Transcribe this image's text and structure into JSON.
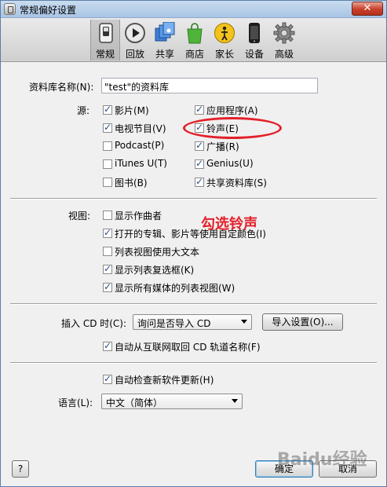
{
  "window": {
    "title": "常规偏好设置",
    "close_label": "✕"
  },
  "toolbar": {
    "items": [
      {
        "label": "常规",
        "icon": "switch-icon"
      },
      {
        "label": "回放",
        "icon": "play-icon"
      },
      {
        "label": "共享",
        "icon": "sharing-icon"
      },
      {
        "label": "商店",
        "icon": "store-bag-icon"
      },
      {
        "label": "家长",
        "icon": "parental-icon"
      },
      {
        "label": "设备",
        "icon": "iphone-icon"
      },
      {
        "label": "高级",
        "icon": "gear-icon"
      }
    ],
    "selected": "常规"
  },
  "library": {
    "label": "资料库名称(N):",
    "value": "\"test\"的资料库"
  },
  "sources": {
    "label": "源:",
    "items": [
      {
        "label": "影片(M)",
        "checked": true
      },
      {
        "label": "应用程序(A)",
        "checked": true
      },
      {
        "label": "电视节目(V)",
        "checked": true
      },
      {
        "label": "铃声(E)",
        "checked": true
      },
      {
        "label": "Podcast(P)",
        "checked": false
      },
      {
        "label": "广播(R)",
        "checked": true
      },
      {
        "label": "iTunes U(T)",
        "checked": false
      },
      {
        "label": "Genius(U)",
        "checked": true
      },
      {
        "label": "图书(B)",
        "checked": false
      },
      {
        "label": "共享资料库(S)",
        "checked": true
      }
    ]
  },
  "views": {
    "label": "视图:",
    "items": [
      {
        "label": "显示作曲者",
        "checked": false
      },
      {
        "label": "打开的专辑、影片等使用自定颜色(I)",
        "checked": true
      },
      {
        "label": "列表视图使用大文本",
        "checked": false
      },
      {
        "label": "显示列表复选框(K)",
        "checked": true
      },
      {
        "label": "显示所有媒体的列表视图(W)",
        "checked": true
      }
    ]
  },
  "cd": {
    "label": "插入 CD 时(C):",
    "selected": "询问是否导入 CD",
    "import_settings_label": "导入设置(O)...",
    "auto_names_label": "自动从互联网取回 CD 轨道名称(F)",
    "auto_names_checked": true
  },
  "updates": {
    "label": "自动检查新软件更新(H)",
    "checked": true
  },
  "language": {
    "label": "语言(L):",
    "selected": "中文（简体）"
  },
  "buttons": {
    "help": "?",
    "ok": "确定",
    "cancel": "取消"
  },
  "annotation": {
    "text": "勾选铃声",
    "color": "#e3202a"
  },
  "watermark": {
    "text": "Baidu经验"
  }
}
